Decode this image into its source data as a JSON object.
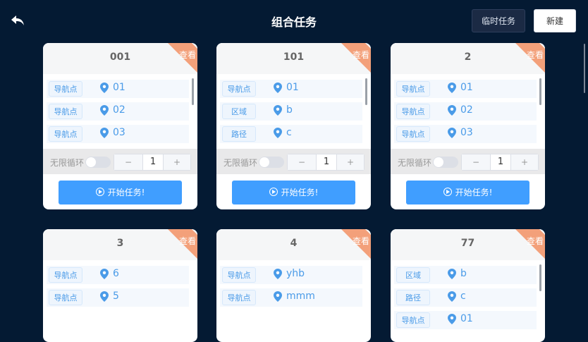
{
  "header": {
    "title": "组合任务",
    "temp_task_label": "临时任务",
    "new_label": "新建"
  },
  "card_corner_label": "查看",
  "loop_label": "无限循环",
  "start_label": "开始任务!",
  "cards": [
    {
      "name": "001",
      "rows": [
        {
          "type": "导航点",
          "value": "01"
        },
        {
          "type": "导航点",
          "value": "02"
        },
        {
          "type": "导航点",
          "value": "03"
        }
      ],
      "count": "1"
    },
    {
      "name": "101",
      "rows": [
        {
          "type": "导航点",
          "value": "01"
        },
        {
          "type": "区域",
          "value": "b"
        },
        {
          "type": "路径",
          "value": "c"
        }
      ],
      "count": "1"
    },
    {
      "name": "2",
      "rows": [
        {
          "type": "导航点",
          "value": "01"
        },
        {
          "type": "导航点",
          "value": "02"
        },
        {
          "type": "导航点",
          "value": "03"
        }
      ],
      "count": "1"
    },
    {
      "name": "3",
      "rows": [
        {
          "type": "导航点",
          "value": "6"
        },
        {
          "type": "导航点",
          "value": "5"
        }
      ]
    },
    {
      "name": "4",
      "rows": [
        {
          "type": "导航点",
          "value": "yhb"
        },
        {
          "type": "导航点",
          "value": "mmm"
        }
      ]
    },
    {
      "name": "77",
      "rows": [
        {
          "type": "区域",
          "value": "b"
        },
        {
          "type": "路径",
          "value": "c"
        },
        {
          "type": "导航点",
          "value": "01"
        }
      ]
    }
  ],
  "colors": {
    "background": "#041a33",
    "accent": "#409eff",
    "corner": "#f3a07a"
  }
}
